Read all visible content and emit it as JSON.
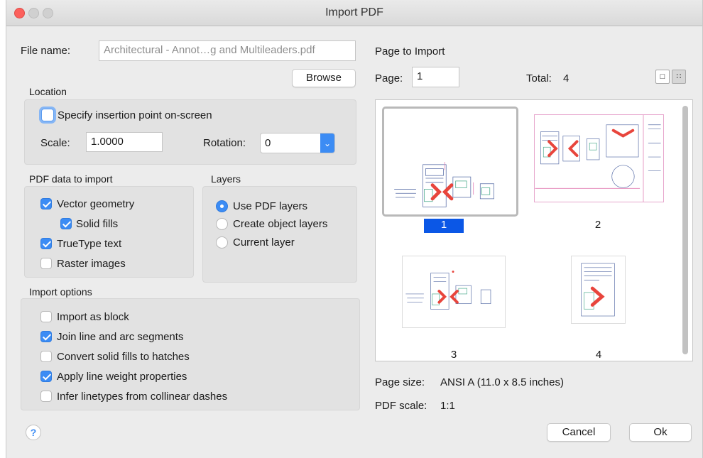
{
  "window": {
    "title": "Import PDF"
  },
  "file": {
    "label": "File name:",
    "value": "Architectural - Annot…g and Multileaders.pdf",
    "browse_label": "Browse"
  },
  "location": {
    "heading": "Location",
    "specify_label": "Specify insertion point on-screen",
    "specify_checked": false,
    "scale_label": "Scale:",
    "scale_value": "1.0000",
    "rotation_label": "Rotation:",
    "rotation_value": "0"
  },
  "pdf_data": {
    "heading": "PDF data to import",
    "items": [
      {
        "label": "Vector geometry",
        "checked": true
      },
      {
        "label": "Solid fills",
        "checked": true
      },
      {
        "label": "TrueType text",
        "checked": true
      },
      {
        "label": "Raster images",
        "checked": false
      }
    ]
  },
  "layers": {
    "heading": "Layers",
    "options": [
      {
        "label": "Use PDF layers",
        "selected": true
      },
      {
        "label": "Create object layers",
        "selected": false
      },
      {
        "label": "Current layer",
        "selected": false
      }
    ]
  },
  "import_options": {
    "heading": "Import options",
    "items": [
      {
        "label": "Import as block",
        "checked": false
      },
      {
        "label": "Join line and arc segments",
        "checked": true
      },
      {
        "label": "Convert solid fills to hatches",
        "checked": false
      },
      {
        "label": "Apply line weight properties",
        "checked": true
      },
      {
        "label": "Infer linetypes from collinear dashes",
        "checked": false
      }
    ]
  },
  "page_import": {
    "heading": "Page to Import",
    "page_label": "Page:",
    "page_value": "1",
    "total_label": "Total:",
    "total_value": "4",
    "thumbnails": [
      {
        "label": "1",
        "selected": true
      },
      {
        "label": "2",
        "selected": false
      },
      {
        "label": "3",
        "selected": false
      },
      {
        "label": "4",
        "selected": false
      }
    ],
    "view_icons": [
      "single-page-view-icon",
      "grid-view-icon"
    ]
  },
  "info": {
    "page_size_label": "Page size:",
    "page_size_value": "ANSI A (11.0 x 8.5 inches)",
    "pdf_scale_label": "PDF scale:",
    "pdf_scale_value": "1:1"
  },
  "footer": {
    "help_symbol": "?",
    "cancel_label": "Cancel",
    "ok_label": "Ok"
  },
  "colors": {
    "accent": "#3c8cf4",
    "selection": "#0b57e6",
    "close_button": "#fc605c",
    "drawing_red": "#e8453c"
  }
}
